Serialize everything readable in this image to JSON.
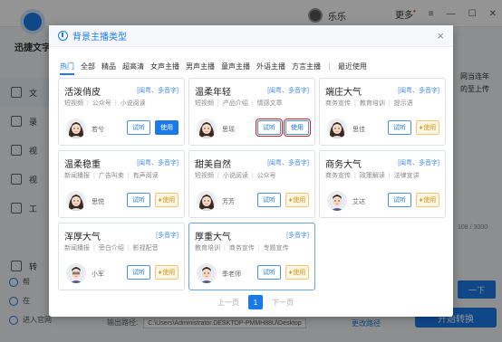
{
  "app": {
    "brand": "迅捷文字",
    "username": "乐乐",
    "more_label": "更多",
    "more_badge": "•",
    "sidebar": [
      "文",
      "录",
      "视",
      "视",
      "工",
      "转"
    ],
    "bottom_links": [
      "帮",
      "在",
      "进入官网"
    ],
    "right_note_lines": [
      "网当连年",
      "的至上传"
    ],
    "counter": "108 / 3000",
    "next_label": "一下",
    "convert_label": "开始转换",
    "output_label": "输出路径:",
    "output_path": "C:\\Users\\Administrator.DESKTOP-PMMH88U\\Desktop",
    "change_path": "更改路径"
  },
  "dialog": {
    "title": "背景主播类型",
    "close": "×",
    "tabs": [
      "热门",
      "全部",
      "精品",
      "超高清",
      "女声主播",
      "男声主播",
      "童声主播",
      "外语主播",
      "方言主播"
    ],
    "recent_tab": "最近使用",
    "active_tab": 0,
    "cards": [
      {
        "name": "活泼俏皮",
        "lang": "[闽粤、多音字]",
        "tags": [
          "短视频",
          "公众号",
          "小说阅读"
        ],
        "person": "若兮",
        "avatar": "f1",
        "action": "use"
      },
      {
        "name": "温柔年轻",
        "lang": "[闽粤、多音字]",
        "tags": [
          "短视频",
          "产品介绍",
          "情感文章"
        ],
        "person": "思瑶",
        "avatar": "f2",
        "action": "use",
        "highlight": true
      },
      {
        "name": "端庄大气",
        "lang": "[闽粤、多音字]",
        "tags": [
          "商务宣传",
          "教育培训",
          "提示语"
        ],
        "person": "思佳",
        "avatar": "f3",
        "action": "vip"
      },
      {
        "name": "温柔稳重",
        "lang": "[闽粤、多音字]",
        "tags": [
          "新闻播报",
          "广告叫卖",
          "有声阅读"
        ],
        "person": "思悦",
        "avatar": "f4",
        "action": "vip"
      },
      {
        "name": "甜美自然",
        "lang": "[闽粤、多音字]",
        "tags": [
          "短视频",
          "小说阅读",
          "公众号"
        ],
        "person": "芳芳",
        "avatar": "f5",
        "action": "vip"
      },
      {
        "name": "商务大气",
        "lang": "[闽粤、多音字]",
        "tags": [
          "商务宣传",
          "政策解读",
          "法律宣讲"
        ],
        "person": "艾达",
        "avatar": "m1",
        "action": "vip"
      },
      {
        "name": "浑厚大气",
        "lang": "[多音字]",
        "tags": [
          "新闻播报",
          "旁白介绍",
          "影视配音"
        ],
        "person": "小军",
        "avatar": "m2",
        "action": "vip"
      },
      {
        "name": "厚重大气",
        "lang": "[多音字]",
        "tags": [
          "教育培训",
          "商务宣传",
          "专题宣传"
        ],
        "person": "季老师",
        "avatar": "m3",
        "action": "vip",
        "selected": true
      }
    ],
    "try_label": "试听",
    "use_label": "使用",
    "vip_label": "使用",
    "pager": {
      "prev": "上一页",
      "current": "1",
      "next": "下一页"
    }
  },
  "colors": {
    "accent": "#1a7be8",
    "vip": "#f0c878",
    "highlight": "#e02020"
  }
}
